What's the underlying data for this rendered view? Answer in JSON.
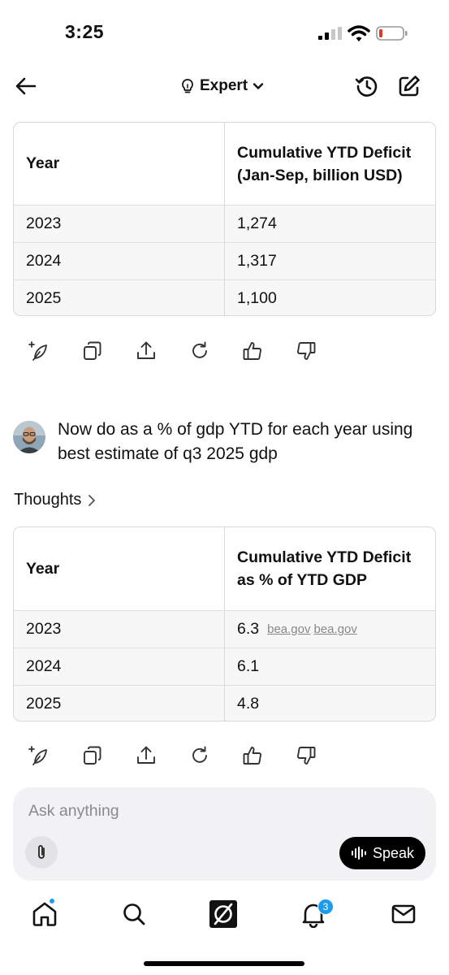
{
  "status_bar": {
    "time": "3:25"
  },
  "nav": {
    "mode_label": "Expert",
    "icons": [
      "back-arrow-icon",
      "lightbulb-icon",
      "chevron-down-icon",
      "history-icon",
      "edit-icon"
    ]
  },
  "table1": {
    "headers": [
      "Year",
      "Cumulative YTD Deficit (Jan-Sep, billion USD)"
    ],
    "rows": [
      {
        "year": "2023",
        "value": "1,274"
      },
      {
        "year": "2024",
        "value": "1,317"
      },
      {
        "year": "2025",
        "value": "1,100"
      }
    ]
  },
  "actions": [
    "regenerate-spark-icon",
    "copy-icon",
    "share-icon",
    "retry-icon",
    "thumbs-up-icon",
    "thumbs-down-icon"
  ],
  "user_message": {
    "text": "Now do as a % of gdp YTD for each year using best estimate of q3 2025 gdp"
  },
  "thoughts_label": "Thoughts",
  "table2": {
    "headers": [
      "Year",
      "Cumulative YTD Deficit as % of YTD GDP"
    ],
    "rows": [
      {
        "year": "2023",
        "value": "6.3",
        "citations": [
          "bea.gov",
          "bea.gov"
        ]
      },
      {
        "year": "2024",
        "value": "6.1"
      },
      {
        "year": "2025",
        "value": "4.8"
      }
    ]
  },
  "composer": {
    "placeholder": "Ask anything",
    "speak_label": "Speak"
  },
  "tab_bar": {
    "tabs": [
      "home-icon",
      "search-icon",
      "grok-icon",
      "notifications-icon",
      "messages-icon"
    ],
    "notification_count": "3"
  },
  "colors": {
    "accent": "#1d9bf0",
    "table_row_bg": "#f7f7f7",
    "composer_bg": "#f2f2f4"
  }
}
